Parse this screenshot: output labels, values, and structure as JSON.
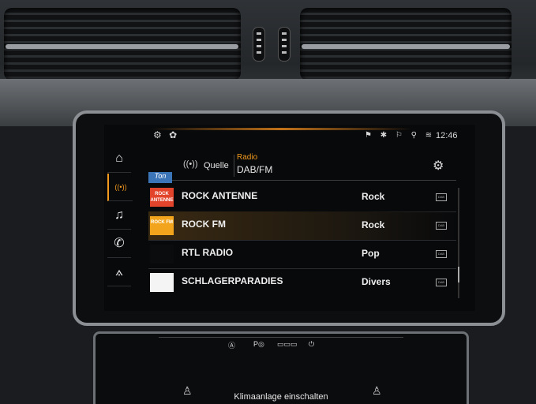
{
  "status_bar": {
    "left_icons": "⚙ ✿",
    "right_icons": "⚑ ✱ ⚐ ⚲ ≋",
    "time": "12:46"
  },
  "sidebar": {
    "items": [
      {
        "icon": "home-icon",
        "glyph": "⌂"
      },
      {
        "icon": "radio-icon",
        "glyph": "((•))"
      },
      {
        "icon": "music-icon",
        "glyph": "♫"
      },
      {
        "icon": "phone-icon",
        "glyph": "✆"
      },
      {
        "icon": "navigation-icon",
        "glyph": "⟑"
      }
    ]
  },
  "header": {
    "source_label": "Quelle",
    "source_icon": "((•))",
    "title": "Radio",
    "subtitle": "DAB/FM"
  },
  "partial_logo": "Ton",
  "stations": [
    {
      "name": "ROCK ANTENNE",
      "genre": "Rock",
      "logo_text": "ROCK ANTENNE",
      "logo_color": "#e2432b",
      "band": "DAB",
      "active": false
    },
    {
      "name": "ROCK FM",
      "genre": "Rock",
      "logo_text": "ROCK FM",
      "logo_color": "#f2a41c",
      "band": "DAB",
      "active": true
    },
    {
      "name": "RTL RADIO",
      "genre": "Pop",
      "logo_text": "",
      "logo_color": "#0b0c0e",
      "band": "DAB",
      "active": false
    },
    {
      "name": "SCHLAGERPARADIES",
      "genre": "Divers",
      "logo_text": "",
      "logo_color": "#f4f4f4",
      "band": "DAB",
      "active": false
    }
  ],
  "climate": {
    "controls": [
      "Ⓐ",
      "P◎",
      "▭▭▭",
      "⏻"
    ],
    "label": "Klimaanlage einschalten"
  },
  "colors": {
    "accent": "#f29a1e"
  }
}
